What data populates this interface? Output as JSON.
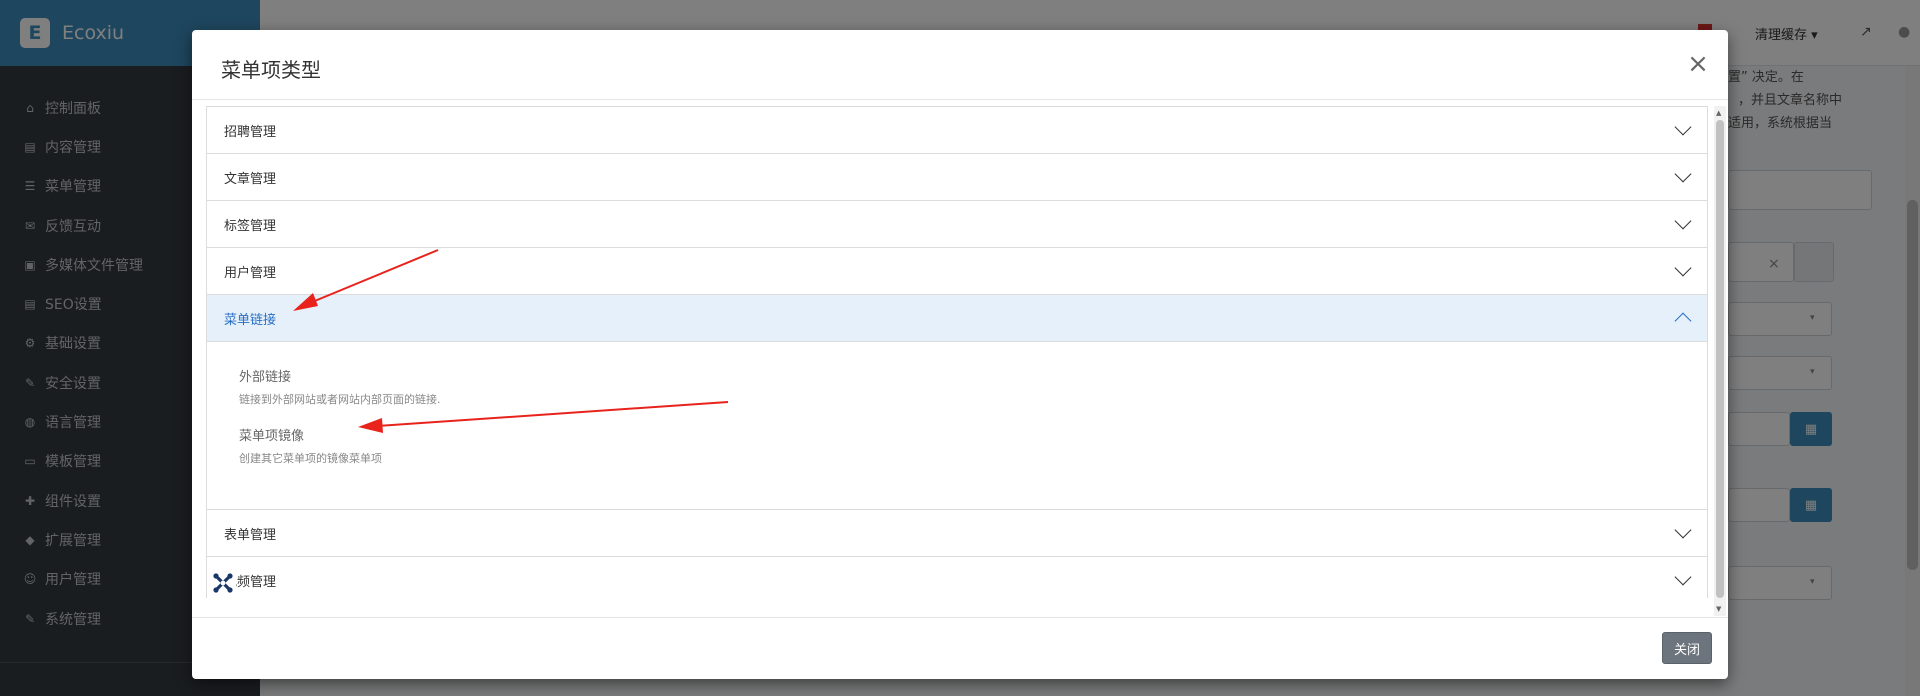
{
  "app": {
    "name": "Ecoxiu",
    "logo_letter": "E"
  },
  "sidebar": {
    "items": [
      {
        "icon": "home-icon",
        "glyph": "⌂",
        "label": "控制面板"
      },
      {
        "icon": "file-icon",
        "glyph": "▤",
        "label": "内容管理"
      },
      {
        "icon": "list-icon",
        "glyph": "☰",
        "label": "菜单管理"
      },
      {
        "icon": "comments-icon",
        "glyph": "✉",
        "label": "反馈互动"
      },
      {
        "icon": "image-icon",
        "glyph": "▣",
        "label": "多媒体文件管理"
      },
      {
        "icon": "file-icon",
        "glyph": "▤",
        "label": "SEO设置"
      },
      {
        "icon": "gear-icon",
        "glyph": "⚙",
        "label": "基础设置"
      },
      {
        "icon": "wrench-icon",
        "glyph": "✎",
        "label": "安全设置"
      },
      {
        "icon": "globe-icon",
        "glyph": "◍",
        "label": "语言管理"
      },
      {
        "icon": "laptop-icon",
        "glyph": "▭",
        "label": "模板管理"
      },
      {
        "icon": "puzzle-icon",
        "glyph": "✚",
        "label": "组件设置"
      },
      {
        "icon": "cube-icon",
        "glyph": "◆",
        "label": "扩展管理"
      },
      {
        "icon": "users-icon",
        "glyph": "☺",
        "label": "用户管理"
      },
      {
        "icon": "wrench-icon",
        "glyph": "✎",
        "label": "系统管理"
      }
    ]
  },
  "topbar": {
    "clear_cache_label": "清理缓存",
    "clear_cache_caret": "▾"
  },
  "background": {
    "text_line1": "置” 决定。在",
    "text_line2": "，并且文章名称中",
    "text_line3": "适用，系统根据当",
    "clear_x": "×",
    "caret": "▾",
    "calendar_glyph": "▦"
  },
  "modal": {
    "title": "菜单项类型",
    "close_glyph": "×",
    "accordion": [
      {
        "label": "招聘管理",
        "expanded": false
      },
      {
        "label": "文章管理",
        "expanded": false
      },
      {
        "label": "标签管理",
        "expanded": false
      },
      {
        "label": "用户管理",
        "expanded": false
      },
      {
        "label": "菜单链接",
        "expanded": true,
        "items": [
          {
            "title": "外部链接",
            "description": "链接到外部网站或者网站内部页面的链接."
          },
          {
            "title": "菜单项镜像",
            "description": "创建其它菜单项的镜像菜单项"
          }
        ]
      },
      {
        "label": "表单管理",
        "expanded": false
      },
      {
        "label": "视频管理",
        "expanded": false
      }
    ],
    "close_button_label": "关闭"
  },
  "colors": {
    "accent": "#3c8dbc",
    "sidebar_bg": "#343a40",
    "active_header_bg": "#e6f0fb",
    "active_header_text": "#2870c4",
    "annotation_arrow": "#e8231c"
  }
}
